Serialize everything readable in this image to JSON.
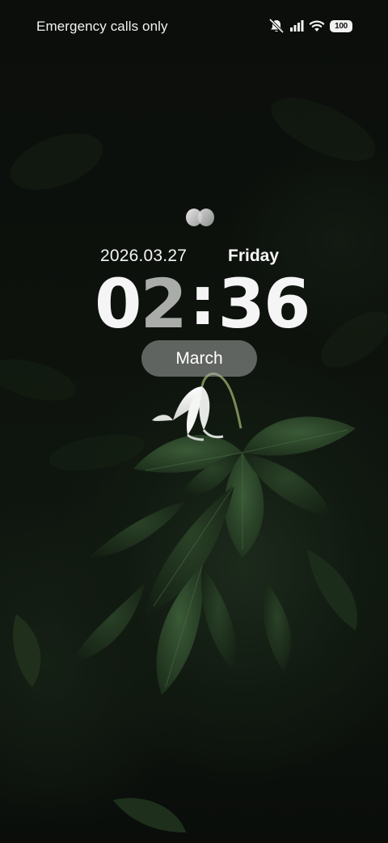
{
  "status_bar": {
    "carrier_text": "Emergency calls only",
    "battery_level": "100",
    "icons": [
      "bell-muted-icon",
      "signal-icon",
      "wifi-icon",
      "battery-icon"
    ]
  },
  "clock": {
    "date": "2026.03.27",
    "weekday": "Friday",
    "hour_tens": "0",
    "hour_ones": "2",
    "separator": ":",
    "minutes": "36",
    "month_label": "March",
    "widget_icon": "dots-icon"
  },
  "colors": {
    "text_primary": "#f5f5f5",
    "hour_accent": "#a9aca9",
    "pill_background": "#a5a8a5",
    "wallpaper_dark": "#0b0e0b",
    "foliage_green": "#2c4a2a"
  }
}
